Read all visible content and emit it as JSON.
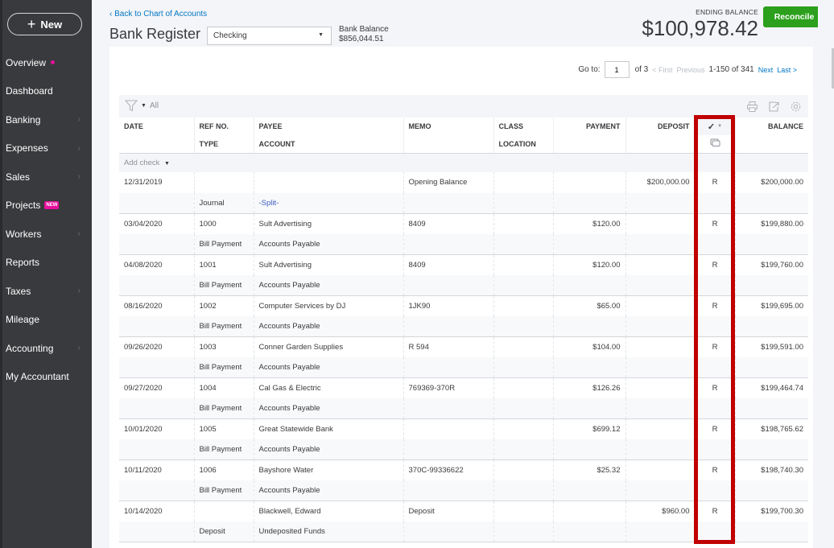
{
  "sidebar": {
    "new_label": "New",
    "items": [
      {
        "label": "Overview",
        "dot": true
      },
      {
        "label": "Dashboard"
      },
      {
        "label": "Banking",
        "chevron": true
      },
      {
        "label": "Expenses",
        "chevron": true
      },
      {
        "label": "Sales",
        "chevron": true
      },
      {
        "label": "Projects",
        "badge": "NEW"
      },
      {
        "label": "Workers",
        "chevron": true
      },
      {
        "label": "Reports"
      },
      {
        "label": "Taxes",
        "chevron": true
      },
      {
        "label": "Mileage"
      },
      {
        "label": "Accounting",
        "chevron": true
      },
      {
        "label": "My Accountant"
      }
    ]
  },
  "header": {
    "back_link": "Back to Chart of Accounts",
    "title": "Bank Register",
    "account": "Checking",
    "bank_balance_label": "Bank Balance",
    "bank_balance_value": "$856,044.51",
    "ending_balance_label": "ENDING BALANCE",
    "ending_balance_value": "$100,978.42",
    "reconcile_label": "Reconcile"
  },
  "pager": {
    "goto_label": "Go to:",
    "page": "1",
    "of_pages": "of 3",
    "first": "< First",
    "previous": "Previous",
    "range": "1-150 of 341",
    "next": "Next",
    "last": "Last >"
  },
  "toolbar": {
    "filter_label": "All"
  },
  "table": {
    "headers": {
      "date": "DATE",
      "ref": "REF NO.",
      "type": "TYPE",
      "payee": "PAYEE",
      "account": "ACCOUNT",
      "memo": "MEMO",
      "class": "CLASS",
      "location": "LOCATION",
      "payment": "PAYMENT",
      "deposit": "DEPOSIT",
      "check": "✓",
      "balance": "BALANCE"
    },
    "add_label": "Add check",
    "rows": [
      {
        "date": "12/31/2019",
        "ref": "",
        "type": "Journal",
        "payee": "",
        "account": "-Split-",
        "memo": "Opening Balance",
        "payment": "",
        "deposit": "$200,000.00",
        "status": "R",
        "balance": "$200,000.00"
      },
      {
        "date": "03/04/2020",
        "ref": "1000",
        "type": "Bill Payment",
        "payee": "Sult Advertising",
        "account": "Accounts Payable",
        "memo": "8409",
        "payment": "$120.00",
        "deposit": "",
        "status": "R",
        "balance": "$199,880.00"
      },
      {
        "date": "04/08/2020",
        "ref": "1001",
        "type": "Bill Payment",
        "payee": "Sult Advertising",
        "account": "Accounts Payable",
        "memo": "8409",
        "payment": "$120.00",
        "deposit": "",
        "status": "R",
        "balance": "$199,760.00"
      },
      {
        "date": "08/16/2020",
        "ref": "1002",
        "type": "Bill Payment",
        "payee": "Computer Services by DJ",
        "account": "Accounts Payable",
        "memo": "1JK90",
        "payment": "$65.00",
        "deposit": "",
        "status": "R",
        "balance": "$199,695.00"
      },
      {
        "date": "09/26/2020",
        "ref": "1003",
        "type": "Bill Payment",
        "payee": "Conner Garden Supplies",
        "account": "Accounts Payable",
        "memo": "R 594",
        "payment": "$104.00",
        "deposit": "",
        "status": "R",
        "balance": "$199,591.00"
      },
      {
        "date": "09/27/2020",
        "ref": "1004",
        "type": "Bill Payment",
        "payee": "Cal Gas & Electric",
        "account": "Accounts Payable",
        "memo": "769369-370R",
        "payment": "$126.26",
        "deposit": "",
        "status": "R",
        "balance": "$199,464.74"
      },
      {
        "date": "10/01/2020",
        "ref": "1005",
        "type": "Bill Payment",
        "payee": "Great Statewide Bank",
        "account": "Accounts Payable",
        "memo": "",
        "payment": "$699.12",
        "deposit": "",
        "status": "R",
        "balance": "$198,765.62"
      },
      {
        "date": "10/11/2020",
        "ref": "1006",
        "type": "Bill Payment",
        "payee": "Bayshore Water",
        "account": "Accounts Payable",
        "memo": "370C-99336622",
        "payment": "$25.32",
        "deposit": "",
        "status": "R",
        "balance": "$198,740.30"
      },
      {
        "date": "10/14/2020",
        "ref": "",
        "type": "Deposit",
        "payee": "Blackwell, Edward",
        "account": "Undeposited Funds",
        "memo": "Deposit",
        "payment": "",
        "deposit": "$960.00",
        "status": "R",
        "balance": "$199,700.30"
      }
    ]
  },
  "colors": {
    "sidebar_bg": "#393a3d",
    "accent_green": "#2ca01c",
    "link_blue": "#0077c5",
    "badge_pink": "#e5109c",
    "highlight_red": "#c00000"
  }
}
